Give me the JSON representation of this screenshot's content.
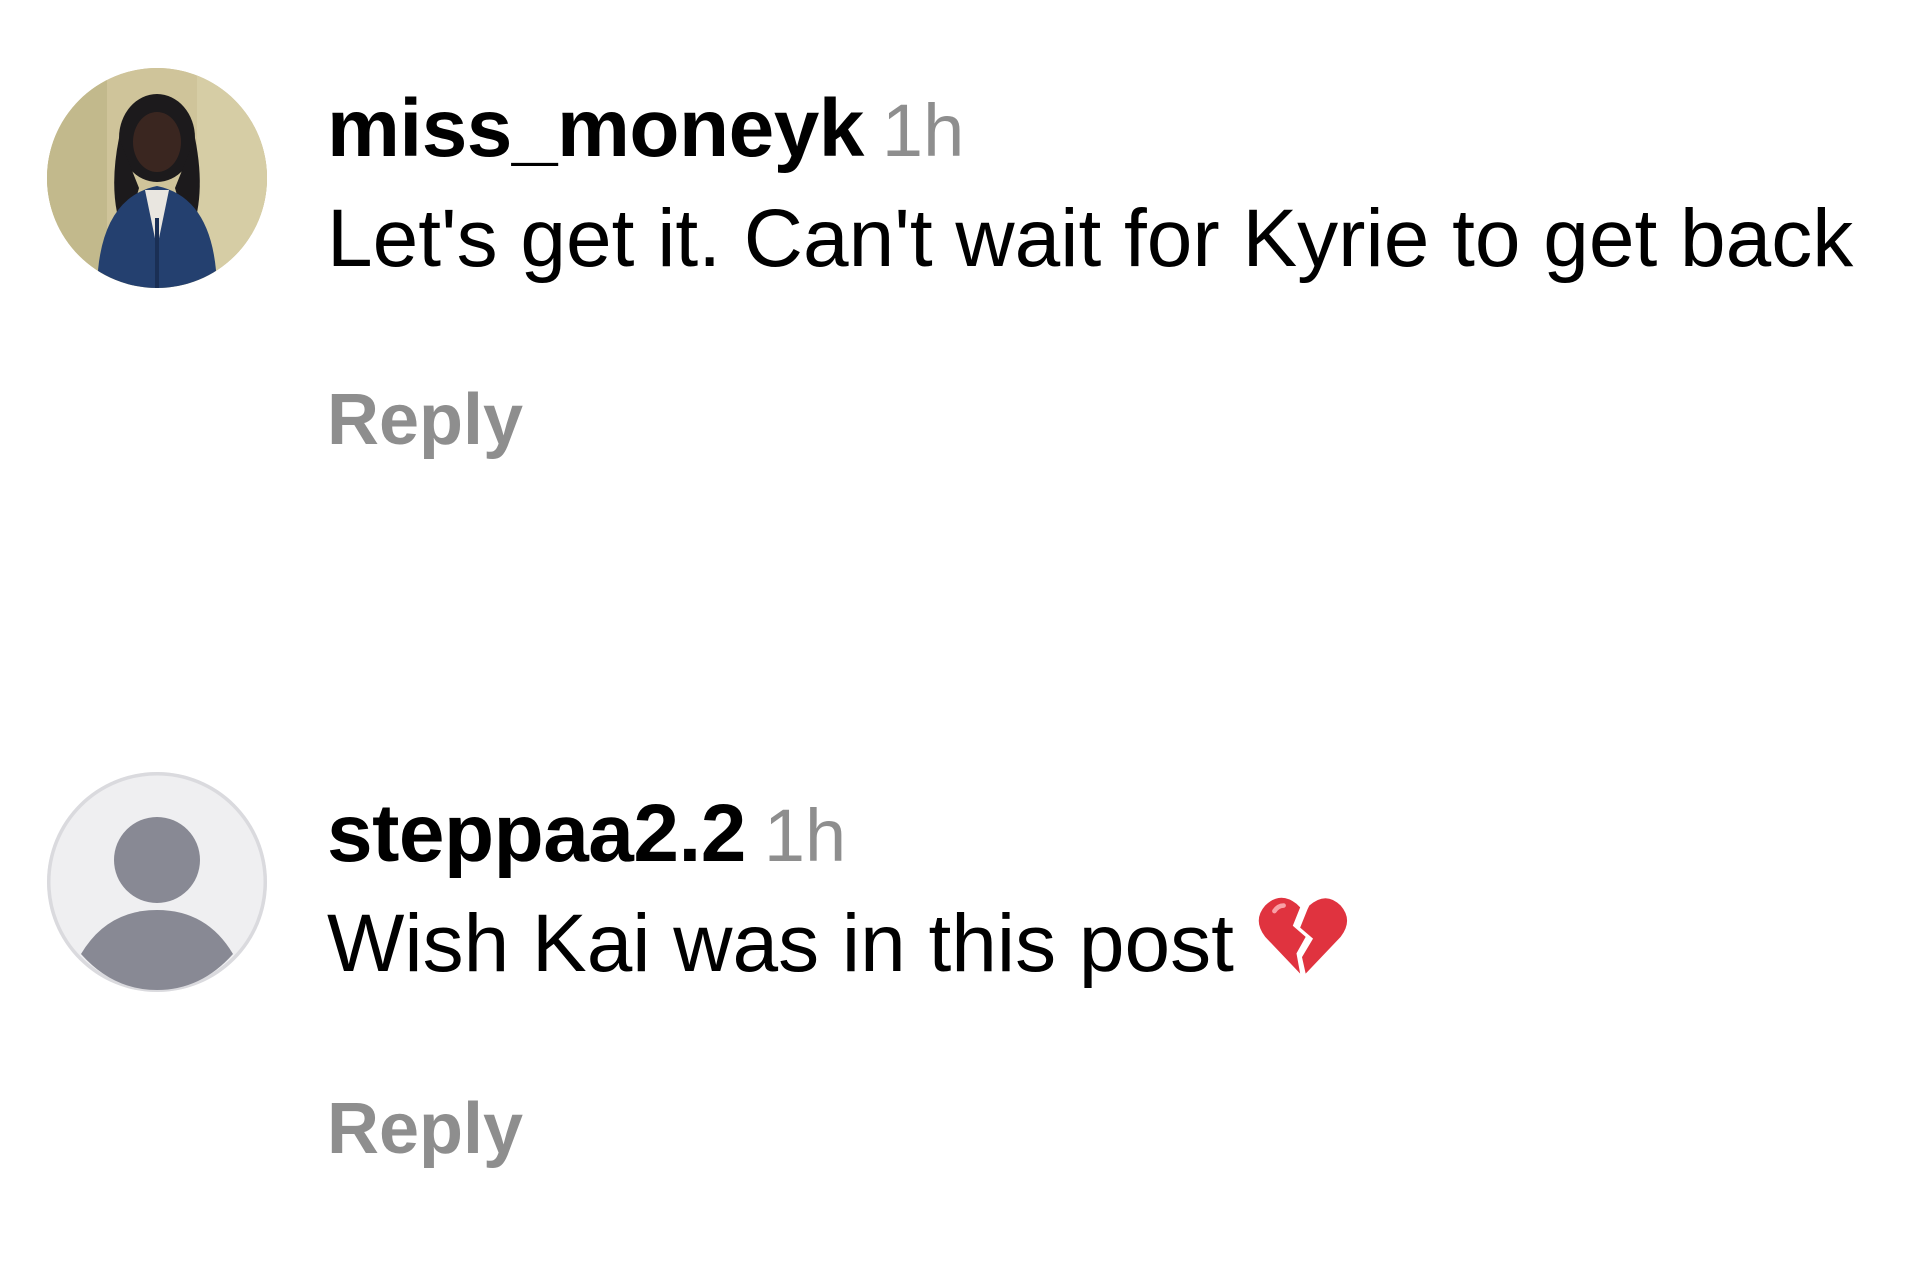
{
  "comments": [
    {
      "username": "miss_moneyk",
      "timestamp": "1h",
      "text": "Let's get it. Can't wait for Kyrie to get back",
      "reply_label": "Reply",
      "avatar": "profile-photo"
    },
    {
      "username": "steppaa2.2",
      "timestamp": "1h",
      "text": "Wish Kai was in this post",
      "emoji": "broken-heart-icon",
      "reply_label": "Reply",
      "avatar": "default-avatar-icon"
    }
  ],
  "colors": {
    "text": "#000000",
    "secondary_text": "#8e8e8e",
    "default_avatar_bg": "#efeff1",
    "default_avatar_silhouette": "#888994",
    "emoji": "#e0333f"
  }
}
